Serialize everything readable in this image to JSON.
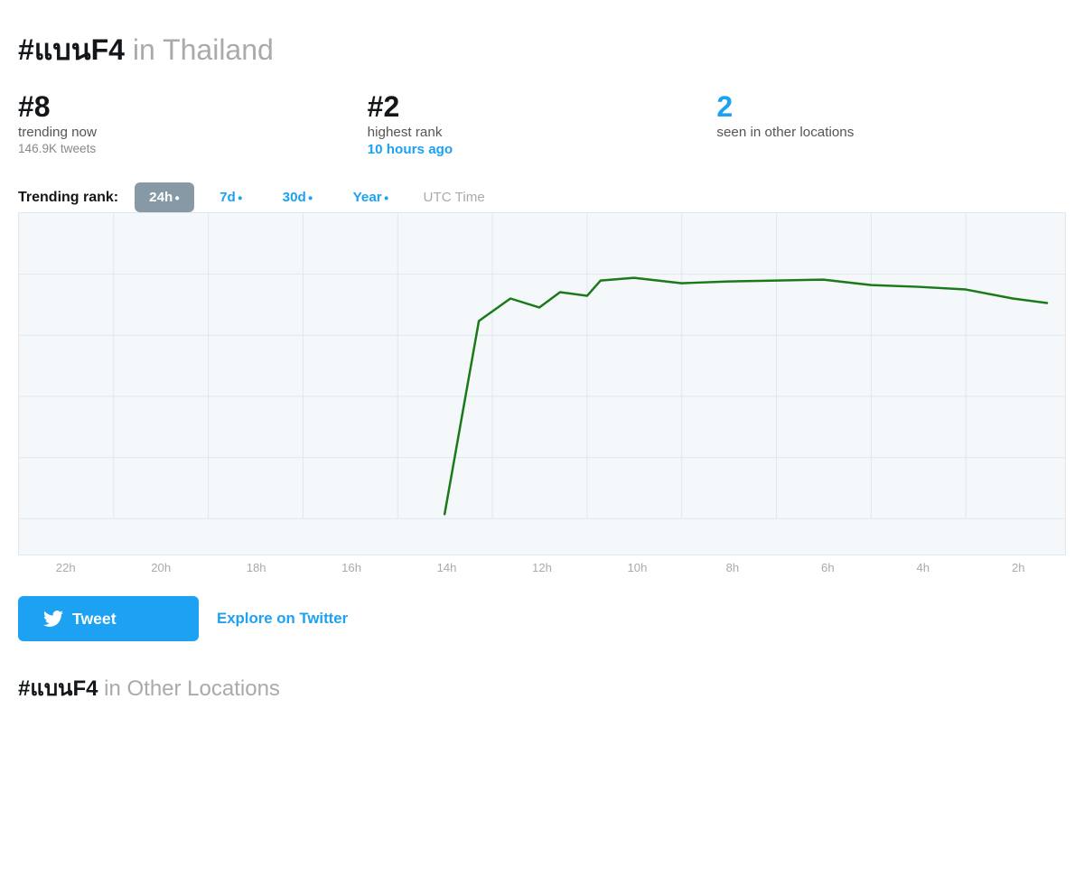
{
  "header": {
    "hashtag": "#แบนF4",
    "location_label": " in Thailand"
  },
  "stats": [
    {
      "number": "#8",
      "label": "trending now",
      "sublabel": "146.9K tweets",
      "link": null
    },
    {
      "number": "#2",
      "label": "highest rank",
      "sublabel": null,
      "link": "10 hours ago"
    },
    {
      "number": "2",
      "label": "seen in other locations",
      "sublabel": null,
      "link": null,
      "number_color": "blue"
    }
  ],
  "tabs": {
    "label": "Trending rank:",
    "items": [
      {
        "id": "24h",
        "label": "24h",
        "active": true
      },
      {
        "id": "7d",
        "label": "7d",
        "active": false
      },
      {
        "id": "30d",
        "label": "30d",
        "active": false
      },
      {
        "id": "year",
        "label": "Year",
        "active": false
      }
    ],
    "utc_label": "UTC Time"
  },
  "chart": {
    "x_labels": [
      "22h",
      "20h",
      "18h",
      "16h",
      "14h",
      "12h",
      "10h",
      "8h",
      "6h",
      "4h",
      "2h"
    ],
    "color": "#1a7a1a",
    "grid_color": "#dde8ef"
  },
  "actions": {
    "tweet_label": "Tweet",
    "explore_label": "Explore on Twitter"
  },
  "footer": {
    "hashtag": "#แบนF4",
    "location_label": " in Other Locations"
  }
}
